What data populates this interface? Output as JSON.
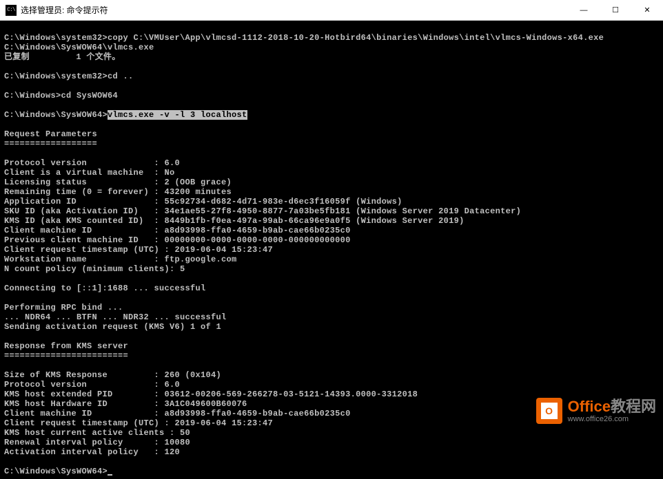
{
  "window": {
    "icon_label": "C:\\",
    "title": "选择管理员: 命令提示符"
  },
  "controls": {
    "minimize": "—",
    "maximize": "☐",
    "close": "✕"
  },
  "term": {
    "line1_prompt": "C:\\Windows\\system32>",
    "line1_cmd": "copy C:\\VMUser\\App\\vlmcsd-1112-2018-10-20-Hotbird64\\binaries\\Windows\\intel\\vlmcs-Windows-x64.exe",
    "line2": "C:\\Windows\\SysWOW64\\vlmcs.exe",
    "line3": "已复制         1 个文件。",
    "line5_prompt": "C:\\Windows\\system32>",
    "line5_cmd": "cd ..",
    "line7_prompt": "C:\\Windows>",
    "line7_cmd": "cd SysWOW64",
    "line9_prompt": "C:\\Windows\\SysWOW64>",
    "line9_cmd": "vlmcs.exe -v -l 3 localhost",
    "reqparams_header": "Request Parameters",
    "reqparams_divider": "==================",
    "protocol_version": "Protocol version             : 6.0",
    "client_vm": "Client is a virtual machine  : No",
    "licensing_status": "Licensing status             : 2 (OOB grace)",
    "remaining_time": "Remaining time (0 = forever) : 43200 minutes",
    "application_id": "Application ID               : 55c92734-d682-4d71-983e-d6ec3f16059f (Windows)",
    "sku_id": "SKU ID (aka Activation ID)   : 34e1ae55-27f8-4950-8877-7a03be5fb181 (Windows Server 2019 Datacenter)",
    "kms_id": "KMS ID (aka KMS counted ID)  : 8449b1fb-f0ea-497a-99ab-66ca96e9a0f5 (Windows Server 2019)",
    "client_machine_id": "Client machine ID            : a8d93998-ffa0-4659-b9ab-cae66b0235c0",
    "prev_client_id": "Previous client machine ID   : 00000000-0000-0000-0000-000000000000",
    "client_req_ts": "Client request timestamp (UTC) : 2019-06-04 15:23:47",
    "workstation_name": "Workstation name             : ftp.google.com",
    "n_count_policy": "N count policy (minimum clients): 5",
    "connecting": "Connecting to [::1]:1688 ... successful",
    "rpc_bind": "Performing RPC bind ...",
    "ndr": "... NDR64 ... BTFN ... NDR32 ... successful",
    "sending": "Sending activation request (KMS V6) 1 of 1",
    "response_header": "Response from KMS server",
    "response_divider": "========================",
    "size_response": "Size of KMS Response         : 260 (0x104)",
    "protocol_v2": "Protocol version             : 6.0",
    "kms_host_pid": "KMS host extended PID        : 03612-00206-569-266278-03-5121-14393.0000-3312018",
    "kms_host_hwid": "KMS host Hardware ID         : 3A1C049600B60076",
    "client_machine_id2": "Client machine ID            : a8d93998-ffa0-4659-b9ab-cae66b0235c0",
    "client_req_ts2": "Client request timestamp (UTC) : 2019-06-04 15:23:47",
    "active_clients": "KMS host current active clients : 50",
    "renewal_policy": "Renewal interval policy      : 10080",
    "activation_policy": "Activation interval policy   : 120",
    "final_prompt": "C:\\Windows\\SysWOW64>"
  },
  "watermark": {
    "icon_letter": "O",
    "title_orange": "Office",
    "title_gray": "教程网",
    "url": "www.office26.com"
  }
}
